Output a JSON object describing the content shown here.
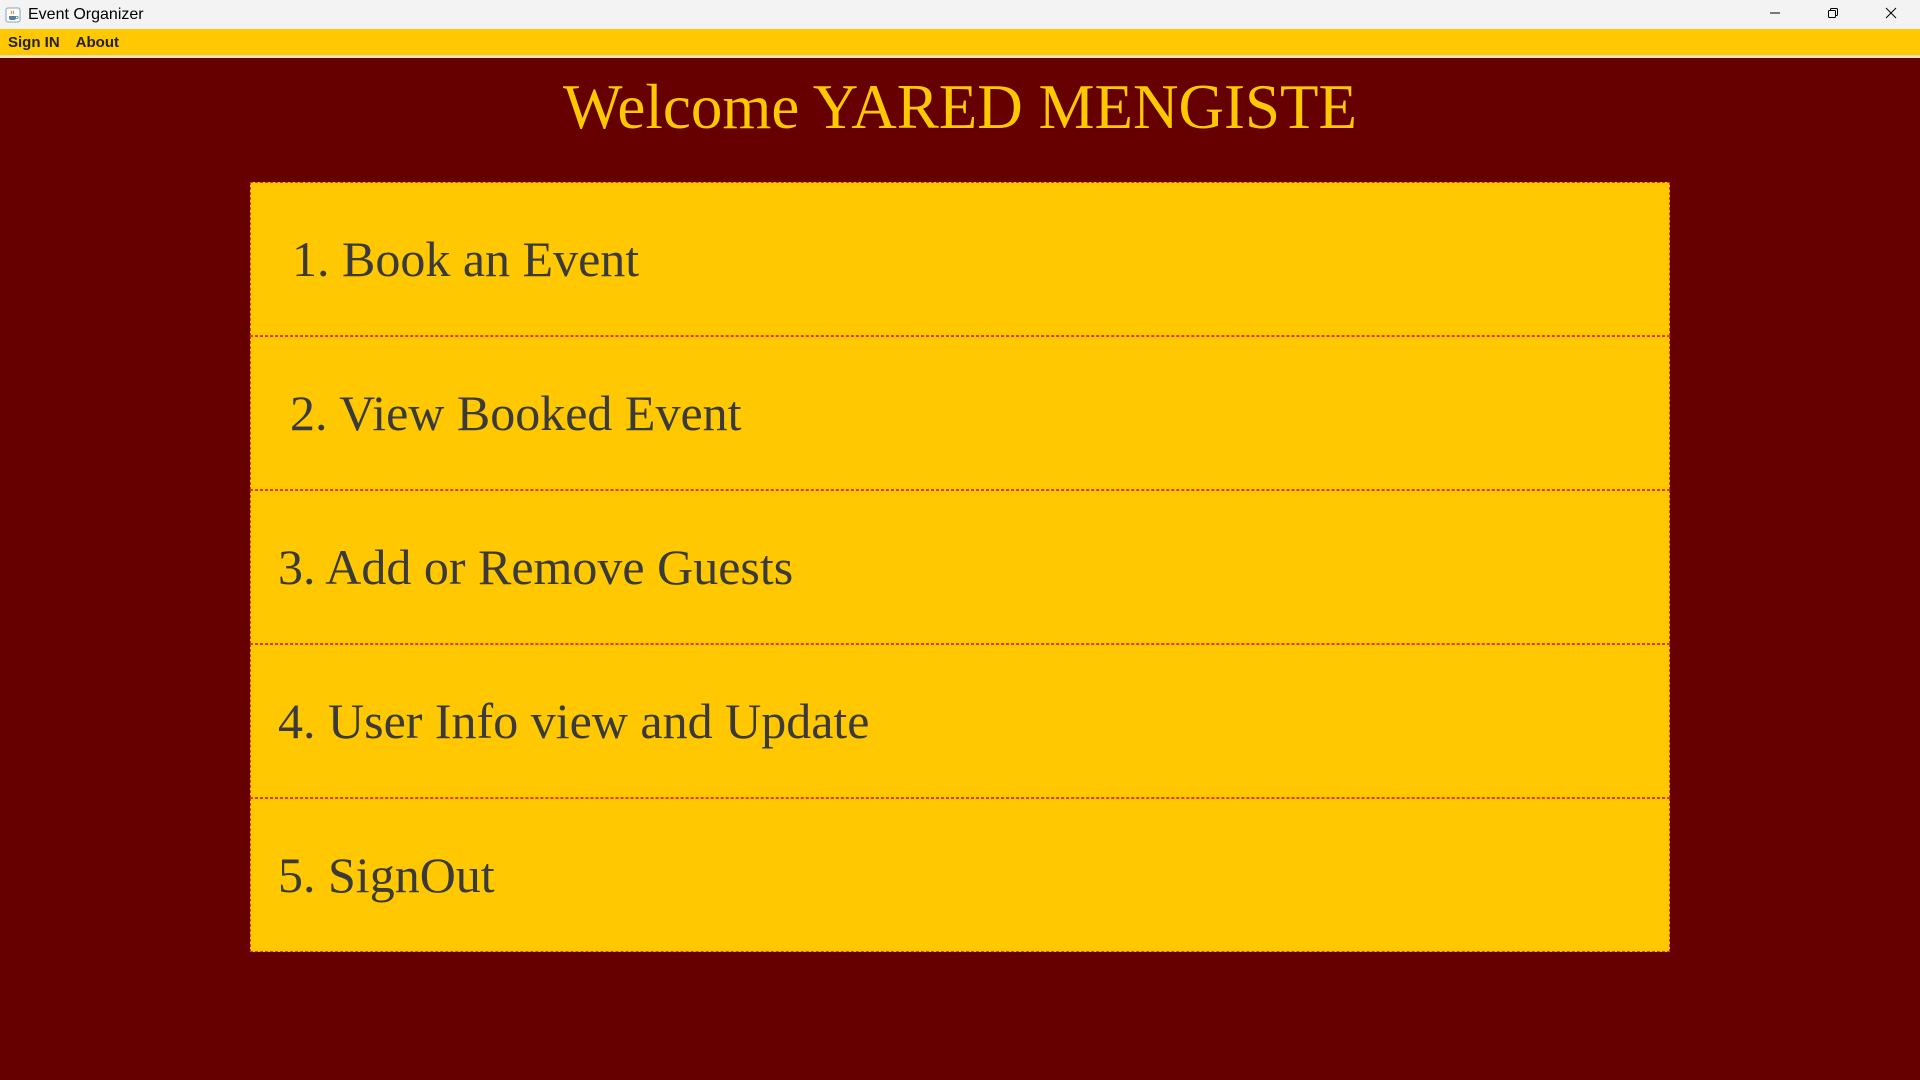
{
  "window": {
    "title": "Event Organizer",
    "icon": "java-cup-icon"
  },
  "menubar": {
    "items": [
      {
        "label": "Sign IN"
      },
      {
        "label": "About"
      }
    ]
  },
  "main": {
    "welcome": "Welcome YARED MENGISTE",
    "options": [
      {
        "label": "1. Book an Event"
      },
      {
        "label": "2. View Booked Event"
      },
      {
        "label": "3. Add or Remove Guests"
      },
      {
        "label": "4. User Info view and Update"
      },
      {
        "label": "5. SignOut"
      }
    ]
  },
  "colors": {
    "background": "#660000",
    "accent": "#ffc800",
    "option_text": "#3a3a3a",
    "border": "#e03020"
  }
}
